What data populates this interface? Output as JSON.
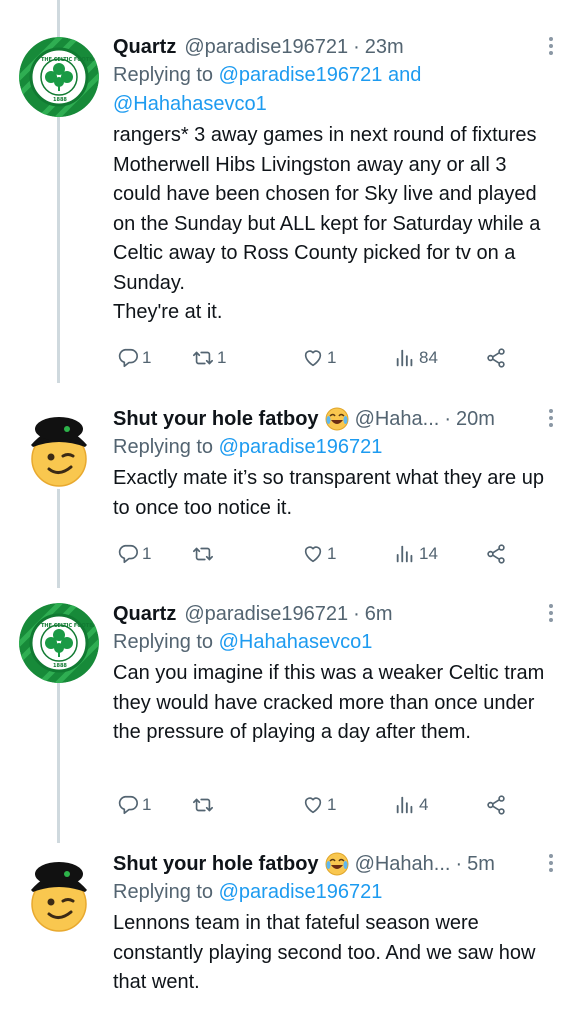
{
  "tweets": [
    {
      "name": "Quartz",
      "handle": "@paradise196721",
      "sep": "·",
      "time": "23m",
      "replying_prefix": "Replying to ",
      "replying_to": "@paradise196721 and",
      "replying_to_2": "@Hahahasevco1",
      "text": "rangers* 3 away games in next round of fixtures Motherwell Hibs Livingston away any or all 3 could have been chosen for Sky live and played on the Sunday but ALL kept for Saturday while a Celtic away to Ross County picked for tv on a Sunday.\nThey're at it.",
      "replies": "1",
      "retweets": "1",
      "likes": "1",
      "views": "84",
      "avatar": "celtic-crest"
    },
    {
      "name": "Shut your hole fatboy",
      "emoji": "tears-of-joy",
      "handle": "@Haha...",
      "sep": "·",
      "time": "20m",
      "replying_prefix": "Replying to ",
      "replying_to": "@paradise196721",
      "text": "Exactly mate it’s so transparent what they are up to once too notice it.",
      "replies": "1",
      "retweets": "",
      "likes": "1",
      "views": "14",
      "avatar": "winking-face-cap"
    },
    {
      "name": "Quartz",
      "handle": "@paradise196721",
      "sep": "·",
      "time": "6m",
      "replying_prefix": "Replying to ",
      "replying_to": "@Hahahasevco1",
      "text": "Can you imagine if this was a weaker Celtic tram they would have cracked more than once under the pressure of playing a day after them.",
      "replies": "1",
      "retweets": "",
      "likes": "1",
      "views": "4",
      "avatar": "celtic-crest"
    },
    {
      "name": "Shut your hole fatboy",
      "emoji": "tears-of-joy",
      "handle": "@Hahah...",
      "sep": "·",
      "time": "5m",
      "replying_prefix": "Replying to ",
      "replying_to": "@paradise196721",
      "text": "Lennons team in that fateful season were constantly playing second too. And we saw how that went.",
      "avatar": "winking-face-cap"
    }
  ],
  "colors": {
    "link": "#1d9bf0",
    "secondary": "#536471",
    "celtic_green": "#1f8a3c"
  }
}
